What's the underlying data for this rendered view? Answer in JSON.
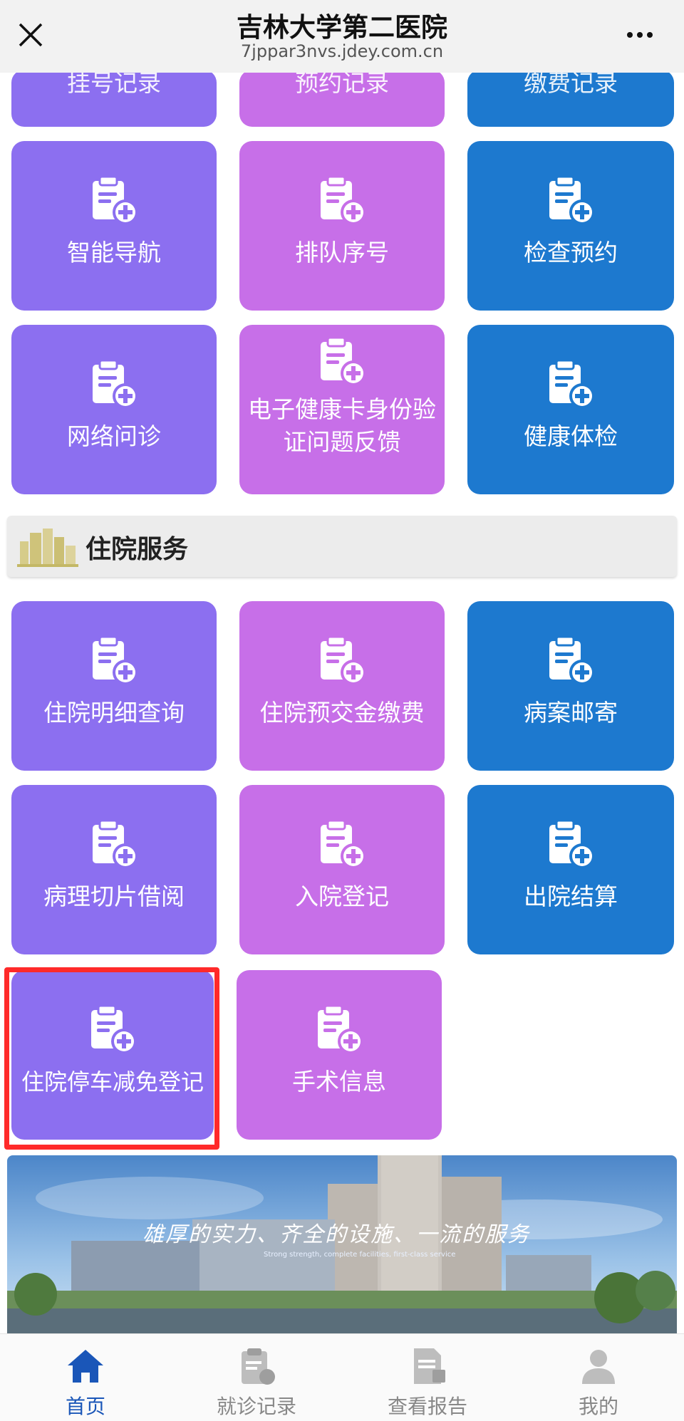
{
  "header": {
    "title": "吉林大学第二医院",
    "url": "7jppar3nvs.jdey.com.cn"
  },
  "partial_row": [
    "挂号记录",
    "预约记录",
    "缴费记录"
  ],
  "tiles_top": [
    {
      "label": "智能导航",
      "color": "purple"
    },
    {
      "label": "排队序号",
      "color": "pink"
    },
    {
      "label": "检查预约",
      "color": "blue"
    },
    {
      "label": "网络问诊",
      "color": "purple"
    },
    {
      "label": "电子健康卡身份验证问题反馈",
      "color": "pink"
    },
    {
      "label": "健康体检",
      "color": "blue"
    }
  ],
  "section": {
    "title": "住院服务"
  },
  "tiles_inpatient": [
    {
      "label": "住院明细查询",
      "color": "purple"
    },
    {
      "label": "住院预交金缴费",
      "color": "pink"
    },
    {
      "label": "病案邮寄",
      "color": "blue"
    },
    {
      "label": "病理切片借阅",
      "color": "purple"
    },
    {
      "label": "入院登记",
      "color": "pink"
    },
    {
      "label": "出院结算",
      "color": "blue"
    },
    {
      "label": "住院停车减免登记",
      "color": "purple"
    },
    {
      "label": "手术信息",
      "color": "pink"
    }
  ],
  "banner": {
    "slogan": "雄厚的实力、齐全的设施、一流的服务",
    "slogan_en": "Strong strength, complete facilities, first-class service"
  },
  "nav": [
    {
      "label": "首页",
      "icon": "home-icon",
      "active": true
    },
    {
      "label": "就诊记录",
      "icon": "record-icon",
      "active": false
    },
    {
      "label": "查看报告",
      "icon": "report-icon",
      "active": false
    },
    {
      "label": "我的",
      "icon": "user-icon",
      "active": false
    }
  ],
  "colors": {
    "purple": "#8c6ff0",
    "pink": "#c76fe8",
    "blue": "#1d79cf",
    "highlight": "#ff2a2a",
    "nav_active": "#1a56b8"
  }
}
